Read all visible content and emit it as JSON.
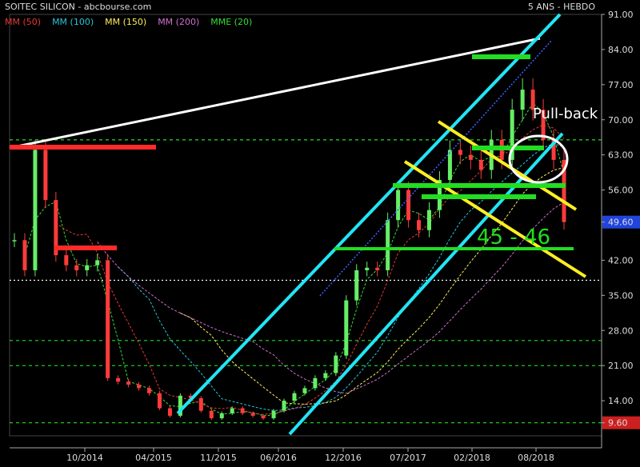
{
  "header": {
    "title": "SOITEC SILICON - abcbourse.com",
    "period": "5 ANS - HEBDO"
  },
  "legend": [
    {
      "label": "MM (50)",
      "color": "#e53935"
    },
    {
      "label": "MM (100)",
      "color": "#26c6da"
    },
    {
      "label": "MM (150)",
      "color": "#ffee58"
    },
    {
      "label": "MM (200)",
      "color": "#d070d0"
    },
    {
      "label": "MME (20)",
      "color": "#33dd33"
    }
  ],
  "annotations": {
    "pullback": "Pull-back",
    "target": "45 - 46"
  },
  "colors": {
    "background": "#000000",
    "up_candle": "#66ee66",
    "down_candle": "#ff3b3b",
    "channel": "#22e5f5",
    "trend_white": "#ffffff",
    "resistance_red": "#ff2a2a",
    "support_green": "#22dd22",
    "downtrend_yellow": "#ffee22"
  },
  "chart_data": {
    "type": "candlestick",
    "x_ticks": [
      "10/2014",
      "04/2015",
      "11/2015",
      "06/2016",
      "12/2016",
      "07/2017",
      "02/2018",
      "08/2018"
    ],
    "y_ticks": [
      91.0,
      84.0,
      77.0,
      70.0,
      63.0,
      56.0,
      49.6,
      42.0,
      35.0,
      28.0,
      21.0,
      14.0,
      9.6
    ],
    "ylim": [
      7.0,
      91.0
    ],
    "highlighted_values": {
      "last": 49.6,
      "max": 86.15,
      "min": 9.6
    },
    "close_series": [
      {
        "date": "05/2014",
        "close": 46.0
      },
      {
        "date": "06/2014",
        "close": 40.0
      },
      {
        "date": "07/2014",
        "close": 64.0
      },
      {
        "date": "08/2014",
        "close": 54.0
      },
      {
        "date": "09/2014",
        "close": 43.0
      },
      {
        "date": "10/2014",
        "close": 41.0
      },
      {
        "date": "11/2014",
        "close": 40.0
      },
      {
        "date": "12/2014",
        "close": 41.0
      },
      {
        "date": "01/2015",
        "close": 42.0
      },
      {
        "date": "02/2015",
        "close": 18.5
      },
      {
        "date": "03/2015",
        "close": 17.8
      },
      {
        "date": "04/2015",
        "close": 17.2
      },
      {
        "date": "05/2015",
        "close": 16.5
      },
      {
        "date": "06/2015",
        "close": 15.5
      },
      {
        "date": "07/2015",
        "close": 12.5
      },
      {
        "date": "08/2015",
        "close": 11.0
      },
      {
        "date": "09/2015",
        "close": 15.0
      },
      {
        "date": "10/2015",
        "close": 14.5
      },
      {
        "date": "11/2015",
        "close": 12.0
      },
      {
        "date": "12/2015",
        "close": 10.5
      },
      {
        "date": "01/2016",
        "close": 11.5
      },
      {
        "date": "02/2016",
        "close": 12.5
      },
      {
        "date": "03/2016",
        "close": 11.5
      },
      {
        "date": "04/2016",
        "close": 11.0
      },
      {
        "date": "05/2016",
        "close": 10.5
      },
      {
        "date": "06/2016",
        "close": 12.0
      },
      {
        "date": "07/2016",
        "close": 14.0
      },
      {
        "date": "08/2016",
        "close": 15.5
      },
      {
        "date": "09/2016",
        "close": 16.5
      },
      {
        "date": "10/2016",
        "close": 18.5
      },
      {
        "date": "11/2016",
        "close": 19.5
      },
      {
        "date": "12/2016",
        "close": 23.0
      },
      {
        "date": "01/2017",
        "close": 34.0
      },
      {
        "date": "02/2017",
        "close": 40.0
      },
      {
        "date": "03/2017",
        "close": 40.5
      },
      {
        "date": "04/2017",
        "close": 40.0
      },
      {
        "date": "05/2017",
        "close": 50.0
      },
      {
        "date": "06/2017",
        "close": 56.0
      },
      {
        "date": "07/2017",
        "close": 50.0
      },
      {
        "date": "08/2017",
        "close": 48.0
      },
      {
        "date": "09/2017",
        "close": 52.0
      },
      {
        "date": "10/2017",
        "close": 58.0
      },
      {
        "date": "11/2017",
        "close": 64.0
      },
      {
        "date": "12/2017",
        "close": 63.0
      },
      {
        "date": "01/2018",
        "close": 62.0
      },
      {
        "date": "02/2018",
        "close": 60.0
      },
      {
        "date": "03/2018",
        "close": 66.0
      },
      {
        "date": "04/2018",
        "close": 62.0
      },
      {
        "date": "05/2018",
        "close": 72.0
      },
      {
        "date": "06/2018",
        "close": 76.0
      },
      {
        "date": "07/2018",
        "close": 72.0
      },
      {
        "date": "08/2018",
        "close": 66.0
      },
      {
        "date": "09/2018",
        "close": 62.0
      },
      {
        "date": "10/2018",
        "close": 49.6
      }
    ]
  }
}
